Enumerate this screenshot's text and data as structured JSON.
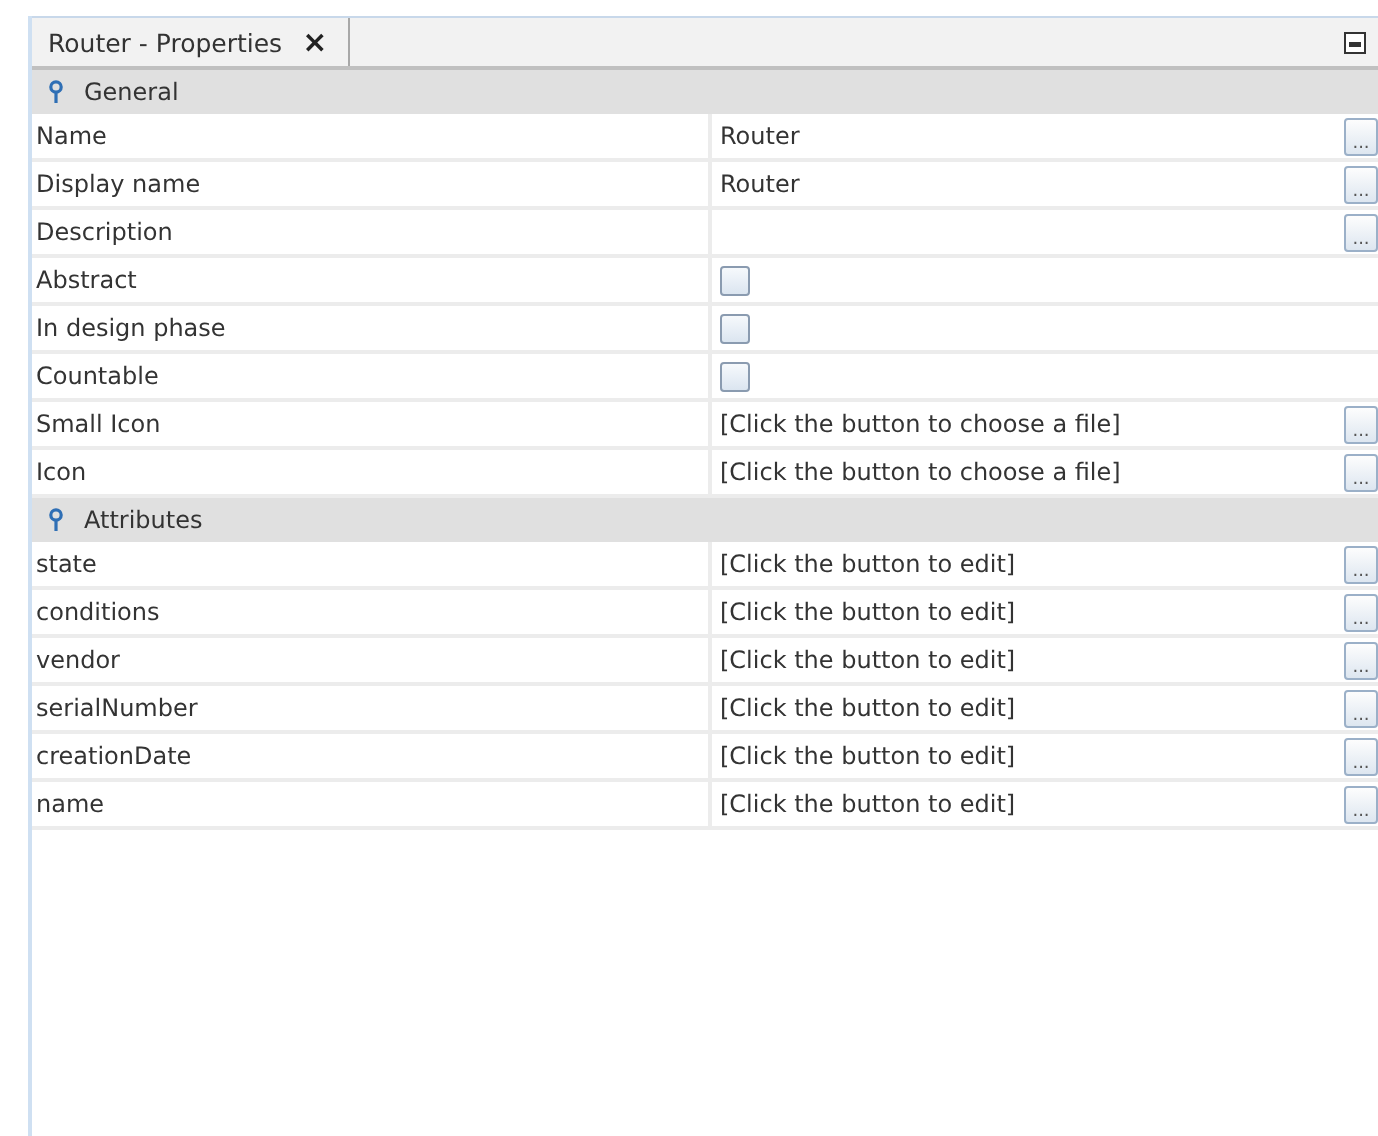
{
  "tab": {
    "title": "Router - Properties",
    "close": "×"
  },
  "sections": [
    {
      "title": "General",
      "expanded": true,
      "rows": [
        {
          "kind": "text",
          "label": "Name",
          "value": "Router",
          "button": "..."
        },
        {
          "kind": "text",
          "label": "Display name",
          "value": "Router",
          "button": "..."
        },
        {
          "kind": "text",
          "label": "Description",
          "button": "..."
        },
        {
          "kind": "checkbox",
          "label": "Abstract",
          "checked": false
        },
        {
          "kind": "checkbox",
          "label": "In design phase",
          "checked": false
        },
        {
          "kind": "checkbox",
          "label": "Countable",
          "checked": false
        },
        {
          "kind": "text",
          "label": "Small Icon",
          "value": "[Click the button to choose a file]",
          "button": "..."
        },
        {
          "kind": "text",
          "label": "Icon",
          "value": "[Click the button to choose a file]",
          "button": "..."
        }
      ]
    },
    {
      "title": "Attributes",
      "expanded": true,
      "rows": [
        {
          "kind": "text",
          "label": "state",
          "value": "[Click the button to edit]",
          "button": "..."
        },
        {
          "kind": "text",
          "label": "conditions",
          "value": "[Click the button to edit]",
          "button": "..."
        },
        {
          "kind": "text",
          "label": "vendor",
          "value": "[Click the button to edit]",
          "button": "..."
        },
        {
          "kind": "text",
          "label": "serialNumber",
          "value": "[Click the button to edit]",
          "button": "..."
        },
        {
          "kind": "text",
          "label": "creationDate",
          "value": "[Click the button to edit]",
          "button": "..."
        },
        {
          "kind": "text",
          "label": "name",
          "value": "[Click the button to edit]",
          "button": "..."
        }
      ]
    }
  ]
}
